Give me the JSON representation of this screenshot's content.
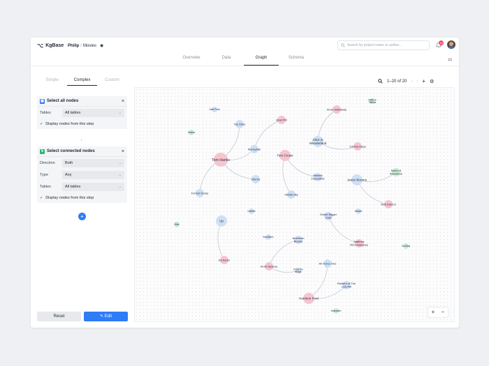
{
  "app": {
    "name": "KgBase"
  },
  "breadcrumb": {
    "owner": "Philip",
    "separator": "/",
    "project": "Movies"
  },
  "search": {
    "placeholder": "Search by project name or author..."
  },
  "notifications": {
    "count": "10"
  },
  "main_tabs": [
    {
      "label": "Overview",
      "active": false
    },
    {
      "label": "Data",
      "active": false
    },
    {
      "label": "Graph",
      "active": true
    },
    {
      "label": "Schema",
      "active": false
    }
  ],
  "query_tabs": [
    {
      "label": "Simple",
      "active": false
    },
    {
      "label": "Complex",
      "active": true
    },
    {
      "label": "Custom",
      "active": false
    }
  ],
  "pagination": {
    "text": "1–20 of 20"
  },
  "step1": {
    "title": "Select all nodes",
    "tables_label": "Tables",
    "tables_value": "All tables",
    "display_label": "Display nodes from this step"
  },
  "step2": {
    "title": "Select connected nodes",
    "direction_label": "Direction",
    "direction_value": "Both",
    "type_label": "Type",
    "type_value": "Any",
    "tables_label": "Tables",
    "tables_value": "All tables",
    "display_label": "Display nodes from this step"
  },
  "buttons": {
    "reset": "Reset",
    "edit": "Edit"
  },
  "colors": {
    "accent": "#2f7cf6",
    "person": "#f6c5cf",
    "movie": "#cfe0f5",
    "genre": "#c9ecd6",
    "badge": "#ef4b63"
  },
  "graph": {
    "nodes": [
      {
        "id": "tomhanks",
        "label": "Tom Hanks",
        "kind": "person",
        "size": "lg"
      },
      {
        "id": "forrest",
        "label": "Forrest Gump",
        "kind": "movie",
        "size": "sm"
      },
      {
        "id": "toystory",
        "label": "Toy Story",
        "kind": "movie",
        "size": "sm"
      },
      {
        "id": "moneyball",
        "label": "Moneyball",
        "kind": "movie",
        "size": "sm"
      },
      {
        "id": "inferno",
        "label": "Inferno",
        "kind": "movie",
        "size": "sm"
      },
      {
        "id": "bradpitt",
        "label": "Brad Pitt",
        "kind": "person",
        "size": "sm"
      },
      {
        "id": "jackfrost",
        "label": "Jack Frost",
        "kind": "movie",
        "size": "xs"
      },
      {
        "id": "drama",
        "label": "Drama",
        "kind": "genre",
        "size": "xs"
      },
      {
        "id": "tomcruise",
        "label": "Tom Cruise",
        "kind": "person",
        "size": "md"
      },
      {
        "id": "mi",
        "label": "Mission Impossible",
        "kind": "movie",
        "size": "sm"
      },
      {
        "id": "vanilla",
        "label": "Vanilla Sky",
        "kind": "movie",
        "size": "sm"
      },
      {
        "id": "anne",
        "label": "Anne Hathaway",
        "kind": "person",
        "size": "sm"
      },
      {
        "id": "alice",
        "label": "Alice in Wonderland",
        "kind": "movie",
        "size": "md"
      },
      {
        "id": "depp",
        "label": "Johnny Depp",
        "kind": "person",
        "size": "sm"
      },
      {
        "id": "neflix",
        "label": "Neflix & Tattoos",
        "kind": "genre",
        "size": "xs"
      },
      {
        "id": "bourne",
        "label": "Jason Bourne",
        "kind": "movie",
        "size": "md"
      },
      {
        "id": "action",
        "label": "Action & Adventure",
        "kind": "genre",
        "size": "sm"
      },
      {
        "id": "damon",
        "label": "Matt Damon",
        "kind": "person",
        "size": "sm"
      },
      {
        "id": "goldie",
        "label": "Goldie Bigger Club",
        "kind": "movie",
        "size": "sm"
      },
      {
        "id": "mcconaughey",
        "label": "Matthew McConaughey",
        "kind": "person",
        "size": "sm"
      },
      {
        "id": "attractr",
        "label": "Attractr",
        "kind": "movie",
        "size": "xs"
      },
      {
        "id": "comedy",
        "label": "Comedy",
        "kind": "genre",
        "size": "xs"
      },
      {
        "id": "unbelie",
        "label": "Unbelie",
        "kind": "movie",
        "size": "xs"
      },
      {
        "id": "kids",
        "label": "Kids",
        "kind": "genre",
        "size": "xs"
      },
      {
        "id": "up",
        "label": "Up",
        "kind": "movie",
        "size": "md"
      },
      {
        "id": "edasner",
        "label": "Ed Asner",
        "kind": "person",
        "size": "sm"
      },
      {
        "id": "imposition",
        "label": "Imposition",
        "kind": "movie",
        "size": "xs"
      },
      {
        "id": "american",
        "label": "American Beauty",
        "kind": "movie",
        "size": "sm"
      },
      {
        "id": "spacey",
        "label": "Kevin Spacey",
        "kind": "person",
        "size": "sm"
      },
      {
        "id": "fromedge",
        "label": "From the Bridge",
        "kind": "movie",
        "size": "xs"
      },
      {
        "id": "airforce",
        "label": "Air Force One",
        "kind": "movie",
        "size": "sm"
      },
      {
        "id": "raiders",
        "label": "Raiders of The Lost Ark",
        "kind": "movie",
        "size": "sm"
      },
      {
        "id": "ford",
        "label": "Harrison Ford",
        "kind": "person",
        "size": "md"
      },
      {
        "id": "animation",
        "label": "Animation",
        "kind": "genre",
        "size": "xs"
      }
    ],
    "edges": [
      [
        "tomhanks",
        "forrest"
      ],
      [
        "tomhanks",
        "toystory"
      ],
      [
        "tomhanks",
        "moneyball"
      ],
      [
        "tomhanks",
        "inferno"
      ],
      [
        "bradpitt",
        "moneyball"
      ],
      [
        "tomcruise",
        "mi"
      ],
      [
        "tomcruise",
        "vanilla"
      ],
      [
        "anne",
        "alice"
      ],
      [
        "alice",
        "depp"
      ],
      [
        "bourne",
        "action"
      ],
      [
        "bourne",
        "damon"
      ],
      [
        "goldie",
        "mcconaughey"
      ],
      [
        "up",
        "edasner"
      ],
      [
        "american",
        "spacey"
      ],
      [
        "spacey",
        "fromedge"
      ],
      [
        "ford",
        "airforce"
      ],
      [
        "ford",
        "raiders"
      ]
    ]
  }
}
